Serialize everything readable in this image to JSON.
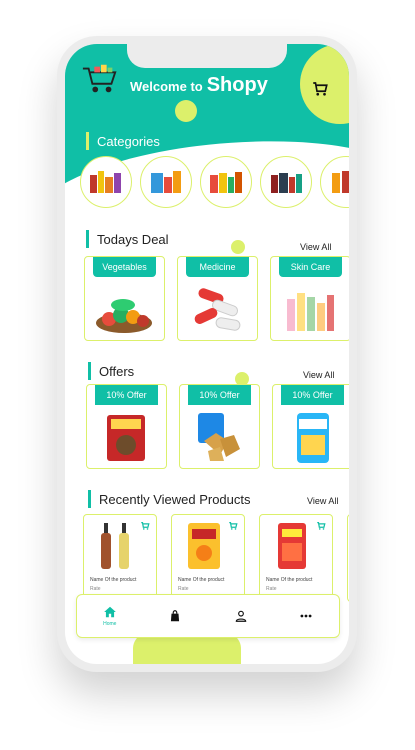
{
  "header": {
    "welcome_text": "Welcome to",
    "brand": "Shopy",
    "icons": [
      "shopping-cart-logo-icon",
      "cart-icon"
    ]
  },
  "categories": {
    "title": "Categories",
    "items": [
      "category-spices",
      "category-packaged-foods",
      "category-grocery-items",
      "category-beverages",
      "category-household"
    ]
  },
  "todays_deal": {
    "title": "Todays Deal",
    "view_all": "View All",
    "cards": [
      {
        "label": "Vegetables",
        "icon": "vegetables-image"
      },
      {
        "label": "Medicine",
        "icon": "medicine-image"
      },
      {
        "label": "Skin Care",
        "icon": "skin-care-image"
      }
    ]
  },
  "offers": {
    "title": "Offers",
    "view_all": "View All",
    "cards": [
      {
        "label": "10% Offer",
        "icon": "masala-pack-image"
      },
      {
        "label": "10% Offer",
        "icon": "chips-pack-image"
      },
      {
        "label": "10% Offer",
        "icon": "snack-pack-image"
      }
    ]
  },
  "recent": {
    "title": "Recently Viewed Products",
    "view_all": "View All",
    "products": [
      {
        "name": "Name Of the product",
        "rate": "Rate"
      },
      {
        "name": "Name Of the product",
        "rate": "Rate"
      },
      {
        "name": "Name Of the product",
        "rate": "Rate"
      }
    ]
  },
  "bottom_nav": {
    "items": [
      {
        "label": "Home",
        "icon": "home-icon"
      },
      {
        "label": "",
        "icon": "shopping-bag-icon"
      },
      {
        "label": "",
        "icon": "profile-icon"
      },
      {
        "label": "",
        "icon": "more-icon"
      }
    ]
  },
  "colors": {
    "primary": "#10bfa6",
    "accent": "#dcf06b"
  }
}
